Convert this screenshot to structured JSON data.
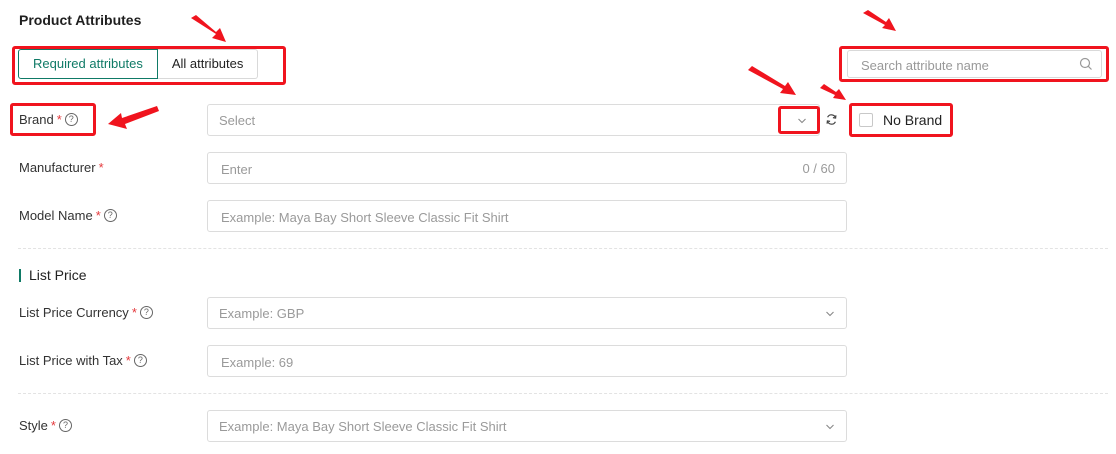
{
  "page": {
    "title": "Product Attributes"
  },
  "tabs": [
    {
      "label": "Required attributes",
      "active": true
    },
    {
      "label": "All attributes",
      "active": false
    }
  ],
  "search": {
    "placeholder": "Search attribute name",
    "icon": "search-icon"
  },
  "fields": {
    "brand": {
      "label": "Brand",
      "placeholder": "Select",
      "required": "*"
    },
    "manufacturer": {
      "label": "Manufacturer",
      "placeholder": "Enter",
      "counter": "0 / 60",
      "required": "*"
    },
    "model_name": {
      "label": "Model Name",
      "placeholder": "Example: Maya Bay Short Sleeve Classic Fit Shirt",
      "required": "*"
    },
    "list_price_currency": {
      "label": "List Price Currency",
      "placeholder": "Example: GBP",
      "required": "*"
    },
    "list_price_with_tax": {
      "label": "List Price with Tax",
      "placeholder": "Example: 69",
      "required": "*"
    },
    "style": {
      "label": "Style",
      "placeholder": "Example: Maya Bay Short Sleeve Classic Fit Shirt",
      "required": "*"
    }
  },
  "no_brand": {
    "label": "No Brand",
    "checked": false
  },
  "sections": {
    "list_price": "List Price"
  },
  "help_glyph": "?",
  "colors": {
    "accent": "#0f7a66",
    "required": "#e4393c",
    "annotation": "#f0141e"
  }
}
